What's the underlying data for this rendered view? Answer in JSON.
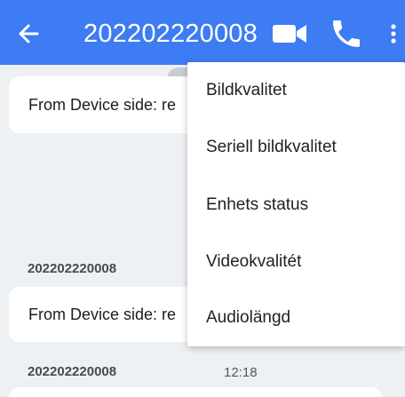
{
  "header": {
    "title": "202202220008",
    "back_icon": "arrow-left-icon",
    "video_icon": "video-camera-icon",
    "call_icon": "phone-icon",
    "more_icon": "more-vertical-icon",
    "color": "#3d7cf2"
  },
  "messages": [
    {
      "text": "From Device side: re"
    },
    {
      "sender": "202202220008",
      "text": "From Device side: re"
    },
    {
      "sender": "202202220008",
      "time": "12:18"
    }
  ],
  "menu": {
    "items": [
      {
        "label": "Bildkvalitet"
      },
      {
        "label": "Seriell bildkvalitet"
      },
      {
        "label": "Enhets status"
      },
      {
        "label": "Videokvalitét"
      },
      {
        "label": "Audiolängd"
      }
    ]
  }
}
